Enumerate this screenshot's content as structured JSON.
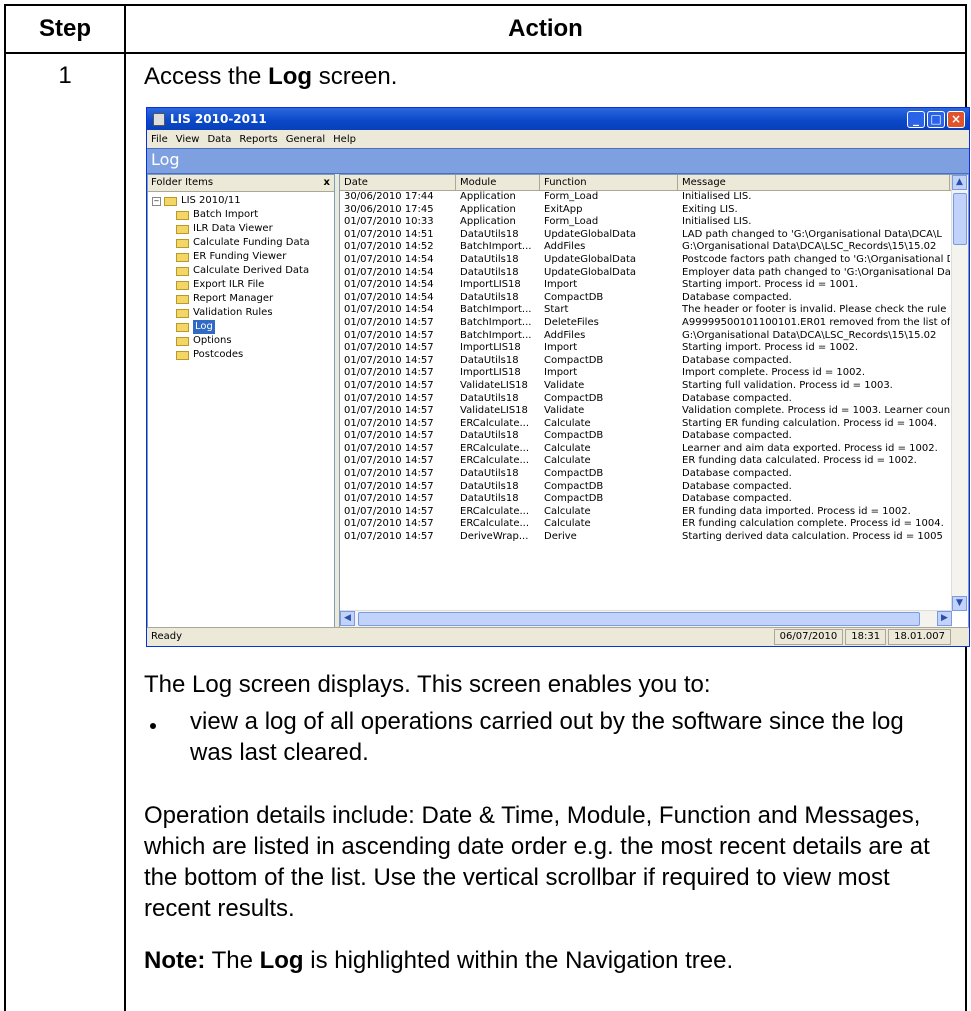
{
  "table": {
    "header_step": "Step",
    "header_action": "Action",
    "step_number": "1"
  },
  "instruction": {
    "prefix": "Access the ",
    "bold": "Log",
    "suffix": " screen."
  },
  "window": {
    "title": "LIS 2010-2011",
    "menu": [
      "File",
      "View",
      "Data",
      "Reports",
      "General",
      "Help"
    ],
    "banner": "Log",
    "folder_header": "Folder Items",
    "tree_root": "LIS 2010/11",
    "tree_items": [
      "Batch Import",
      "ILR Data Viewer",
      "Calculate Funding Data",
      "ER Funding Viewer",
      "Calculate Derived Data",
      "Export ILR File",
      "Report Manager",
      "Validation Rules",
      "Log",
      "Options",
      "Postcodes"
    ],
    "selected_item": "Log",
    "columns": [
      "Date",
      "Module",
      "Function",
      "Message"
    ],
    "rows": [
      [
        "30/06/2010 17:44",
        "Application",
        "Form_Load",
        "Initialised LIS."
      ],
      [
        "30/06/2010 17:45",
        "Application",
        "ExitApp",
        "Exiting LIS."
      ],
      [
        "01/07/2010 10:33",
        "Application",
        "Form_Load",
        "Initialised LIS."
      ],
      [
        "01/07/2010 14:51",
        "DataUtils18",
        "UpdateGlobalData",
        "LAD path changed to 'G:\\Organisational Data\\DCA\\L"
      ],
      [
        "01/07/2010 14:52",
        "BatchImport...",
        "AddFiles",
        "G:\\Organisational Data\\DCA\\LSC_Records\\15\\15.02"
      ],
      [
        "01/07/2010 14:54",
        "DataUtils18",
        "UpdateGlobalData",
        "Postcode factors path changed to 'G:\\Organisational D"
      ],
      [
        "01/07/2010 14:54",
        "DataUtils18",
        "UpdateGlobalData",
        "Employer data path changed to 'G:\\Organisational Dat"
      ],
      [
        "01/07/2010 14:54",
        "ImportLIS18",
        "Import",
        "Starting import. Process id = 1001."
      ],
      [
        "01/07/2010 14:54",
        "DataUtils18",
        "CompactDB",
        "Database compacted."
      ],
      [
        "01/07/2010 14:54",
        "BatchImport...",
        "Start",
        "The header or footer is invalid. Please check the rule v"
      ],
      [
        "01/07/2010 14:57",
        "BatchImport...",
        "DeleteFiles",
        "A99999500101100101.ER01 removed from the list of i"
      ],
      [
        "01/07/2010 14:57",
        "BatchImport...",
        "AddFiles",
        "G:\\Organisational Data\\DCA\\LSC_Records\\15\\15.02"
      ],
      [
        "01/07/2010 14:57",
        "ImportLIS18",
        "Import",
        "Starting import. Process id = 1002."
      ],
      [
        "01/07/2010 14:57",
        "DataUtils18",
        "CompactDB",
        "Database compacted."
      ],
      [
        "01/07/2010 14:57",
        "ImportLIS18",
        "Import",
        "Import complete. Process id = 1002."
      ],
      [
        "01/07/2010 14:57",
        "ValidateLIS18",
        "Validate",
        "Starting full validation. Process id = 1003."
      ],
      [
        "01/07/2010 14:57",
        "DataUtils18",
        "CompactDB",
        "Database compacted."
      ],
      [
        "01/07/2010 14:57",
        "ValidateLIS18",
        "Validate",
        "Validation complete. Process id = 1003. Learner count"
      ],
      [
        "01/07/2010 14:57",
        "ERCalculate...",
        "Calculate",
        "Starting ER funding calculation. Process id = 1004."
      ],
      [
        "01/07/2010 14:57",
        "DataUtils18",
        "CompactDB",
        "Database compacted."
      ],
      [
        "01/07/2010 14:57",
        "ERCalculate...",
        "Calculate",
        "Learner and aim data exported. Process id = 1002."
      ],
      [
        "01/07/2010 14:57",
        "ERCalculate...",
        "Calculate",
        "ER funding data calculated. Process id = 1002."
      ],
      [
        "01/07/2010 14:57",
        "DataUtils18",
        "CompactDB",
        "Database compacted."
      ],
      [
        "01/07/2010 14:57",
        "DataUtils18",
        "CompactDB",
        "Database compacted."
      ],
      [
        "01/07/2010 14:57",
        "DataUtils18",
        "CompactDB",
        "Database compacted."
      ],
      [
        "01/07/2010 14:57",
        "ERCalculate...",
        "Calculate",
        "ER funding data imported. Process id = 1002."
      ],
      [
        "01/07/2010 14:57",
        "ERCalculate...",
        "Calculate",
        "ER funding calculation complete. Process id = 1004."
      ],
      [
        "01/07/2010 14:57",
        "DeriveWrap...",
        "Derive",
        "Starting derived data calculation. Process id = 1005"
      ]
    ],
    "status": {
      "ready": "Ready",
      "date": "06/07/2010",
      "time": "18:31",
      "version": "18.01.007"
    }
  },
  "description": {
    "intro": "The Log screen displays. This screen enables you to:",
    "bullet": "view a log of all operations carried out by the software since the log was last cleared.",
    "details": "Operation details include: Date & Time, Module, Function and Messages, which are listed in ascending date order e.g. the most recent details are at the bottom of the list. Use the vertical scrollbar if required to view most recent results.",
    "note_label": "Note:",
    "note_text_1": " The ",
    "note_bold": "Log",
    "note_text_2": " is highlighted within the Navigation tree."
  }
}
